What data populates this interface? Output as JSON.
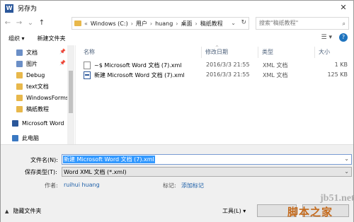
{
  "titlebar": {
    "app_icon": "W",
    "title": "另存为",
    "close_label": "✕"
  },
  "addressbar": {
    "back": "←",
    "forward": "→",
    "recent": "⌄",
    "up": "↑",
    "overflow": "«",
    "crumbs": [
      "Windows (C:)",
      "用户",
      "huang",
      "桌面",
      "稿纸教程"
    ],
    "separator": "›",
    "search_placeholder": "搜索\"稿纸教程\""
  },
  "toolbar": {
    "organize": "组织 ▾",
    "new_folder": "新建文件夹",
    "view_icon": "☰ ▾",
    "help_icon": "?"
  },
  "nav": {
    "items": [
      {
        "label": "文档",
        "icon": "documents-icon",
        "color": "#6b8fc7"
      },
      {
        "label": "图片",
        "icon": "pictures-icon",
        "color": "#6b8fc7"
      },
      {
        "label": "Debug",
        "icon": "folder-icon",
        "color": "#e8b84b"
      },
      {
        "label": "text文档",
        "icon": "folder-icon",
        "color": "#e8b84b"
      },
      {
        "label": "WindowsForms",
        "icon": "folder-icon",
        "color": "#e8b84b"
      },
      {
        "label": "稿纸教程",
        "icon": "folder-icon",
        "color": "#e8b84b"
      },
      {
        "label": "Microsoft Word",
        "icon": "word-icon",
        "color": "#2b579a"
      },
      {
        "label": "此电脑",
        "icon": "computer-icon",
        "color": "#3a78c2"
      }
    ]
  },
  "filelist": {
    "columns": [
      "名称",
      "修改日期",
      "类型",
      "大小"
    ],
    "rows": [
      {
        "name": "~$ Microsoft Word 文档 (7).xml",
        "date": "2016/3/3 21:55",
        "type": "XML 文档",
        "size": "1 KB",
        "icon": "xml-file-icon"
      },
      {
        "name": "新建 Microsoft Word 文档 (7).xml",
        "date": "2016/3/3 21:55",
        "type": "XML 文档",
        "size": "125 KB",
        "icon": "word-xml-file-icon"
      }
    ]
  },
  "form": {
    "filename_label": "文件名(N):",
    "filename_value": "新建 Microsoft Word 文档 (7).xml",
    "savetype_label": "保存类型(T):",
    "savetype_value": "Word XML 文档 (*.xml)",
    "author_label": "作者:",
    "author_value": "ruihui huang",
    "tags_label": "标记:",
    "tags_value": "添加标记"
  },
  "footer": {
    "hide_folders": "隐藏文件夹",
    "tools": "工具(L)  ▾",
    "save": "保存(S)",
    "cancel": "取消"
  },
  "watermark": {
    "line1": "jb51.net",
    "line2": "脚本之家"
  }
}
